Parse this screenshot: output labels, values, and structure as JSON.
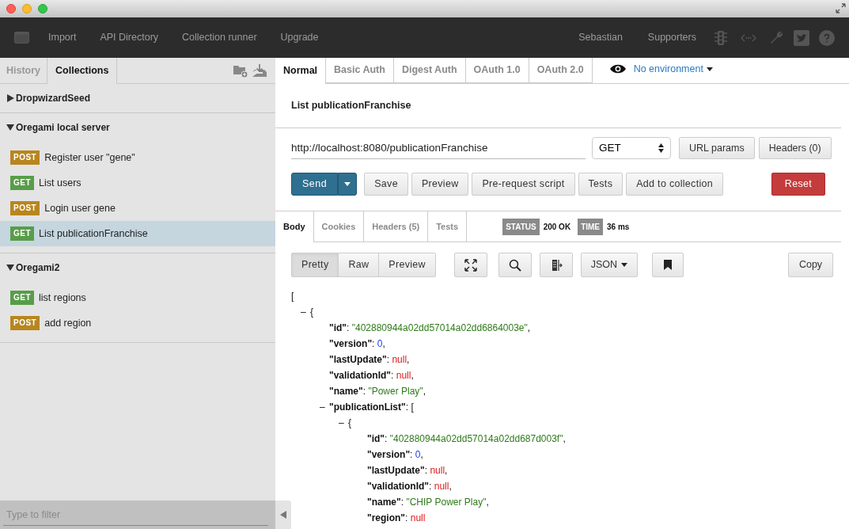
{
  "nav": {
    "items": [
      "Import",
      "API Directory",
      "Collection runner",
      "Upgrade"
    ],
    "user": "Sebastian",
    "supporters": "Supporters"
  },
  "sidebar": {
    "tabs": [
      {
        "label": "History",
        "selected": false
      },
      {
        "label": "Collections",
        "selected": true
      }
    ],
    "collections": [
      {
        "name": "DropwizardSeed",
        "expanded": false
      },
      {
        "name": "Oregami local server",
        "expanded": true,
        "children": [
          {
            "method": "POST",
            "color": "#b8861f",
            "name": "Register user \"gene\"",
            "selected": false
          },
          {
            "method": "GET",
            "color": "#589d48",
            "name": "List users",
            "selected": false
          },
          {
            "method": "POST",
            "color": "#b8861f",
            "name": "Login user gene",
            "selected": false
          },
          {
            "method": "GET",
            "color": "#589d48",
            "name": "List publicationFranchise",
            "selected": true
          }
        ]
      },
      {
        "name": "Oregami2",
        "expanded": true,
        "children": [
          {
            "method": "GET",
            "color": "#589d48",
            "name": "list regions",
            "selected": false
          },
          {
            "method": "POST",
            "color": "#b8861f",
            "name": "add region",
            "selected": false
          }
        ]
      }
    ],
    "filter": {
      "placeholder": "Type to filter"
    }
  },
  "auth_tabs": [
    {
      "label": "Normal",
      "selected": true
    },
    {
      "label": "Basic Auth",
      "selected": false
    },
    {
      "label": "Digest Auth",
      "selected": false
    },
    {
      "label": "OAuth 1.0",
      "selected": false
    },
    {
      "label": "OAuth 2.0",
      "selected": false
    }
  ],
  "environment": "No environment",
  "request": {
    "name": "List publicationFranchise",
    "url": "http://localhost:8080/publicationFranchise",
    "method": "GET",
    "url_params": "URL params",
    "headers": "Headers (0)"
  },
  "actions": [
    {
      "label": "Send",
      "kind": "primary"
    },
    {
      "label": "Save",
      "kind": "normal"
    },
    {
      "label": "Preview",
      "kind": "normal"
    },
    {
      "label": "Pre-request script",
      "kind": "normal"
    },
    {
      "label": "Tests",
      "kind": "normal"
    },
    {
      "label": "Add to collection",
      "kind": "normal"
    },
    {
      "label": "Reset",
      "kind": "danger"
    }
  ],
  "response": {
    "tabs": [
      {
        "label": "Body",
        "selected": true
      },
      {
        "label": "Cookies",
        "selected": false
      },
      {
        "label": "Headers (5)",
        "selected": false
      },
      {
        "label": "Tests",
        "selected": false
      }
    ],
    "status_label": "STATUS",
    "status": "200 OK",
    "time_label": "TIME",
    "time": "36 ms",
    "view_modes": [
      {
        "label": "Pretty",
        "selected": true
      },
      {
        "label": "Raw",
        "selected": false
      },
      {
        "label": "Preview",
        "selected": false
      }
    ],
    "format": "JSON",
    "copy": "Copy",
    "body": [
      {
        "value": "[",
        "kind": "bracket",
        "children": [
          {
            "toggle": "–",
            "value": "{",
            "kind": "bracket",
            "children": [
              {
                "key": "\"id\"",
                "sep": ": ",
                "value": "\"402880944a02dd57014a02dd6864003e\"",
                "kind": "string",
                "end": ","
              },
              {
                "key": "\"version\"",
                "sep": ": ",
                "value": "0",
                "kind": "number",
                "end": ","
              },
              {
                "key": "\"lastUpdate\"",
                "sep": ": ",
                "value": "null",
                "kind": "null",
                "end": ","
              },
              {
                "key": "\"validationId\"",
                "sep": ": ",
                "value": "null",
                "kind": "null",
                "end": ","
              },
              {
                "key": "\"name\"",
                "sep": ": ",
                "value": "\"Power Play\"",
                "kind": "string",
                "end": ","
              },
              {
                "toggle": "–",
                "key": "\"publicationList\"",
                "sep": ": ",
                "value": "[",
                "kind": "bracket",
                "children": [
                  {
                    "toggle": "–",
                    "value": "{",
                    "kind": "bracket",
                    "children": [
                      {
                        "key": "\"id\"",
                        "sep": ": ",
                        "value": "\"402880944a02dd57014a02dd687d003f\"",
                        "kind": "string",
                        "end": ","
                      },
                      {
                        "key": "\"version\"",
                        "sep": ": ",
                        "value": "0",
                        "kind": "number",
                        "end": ","
                      },
                      {
                        "key": "\"lastUpdate\"",
                        "sep": ": ",
                        "value": "null",
                        "kind": "null",
                        "end": ","
                      },
                      {
                        "key": "\"validationId\"",
                        "sep": ": ",
                        "value": "null",
                        "kind": "null",
                        "end": ","
                      },
                      {
                        "key": "\"name\"",
                        "sep": ": ",
                        "value": "\"CHIP Power Play\"",
                        "kind": "string",
                        "end": ","
                      },
                      {
                        "key": "\"region\"",
                        "sep": ": ",
                        "value": "null",
                        "kind": "null"
                      }
                    ]
                  }
                ]
              }
            ]
          }
        ]
      }
    ]
  }
}
